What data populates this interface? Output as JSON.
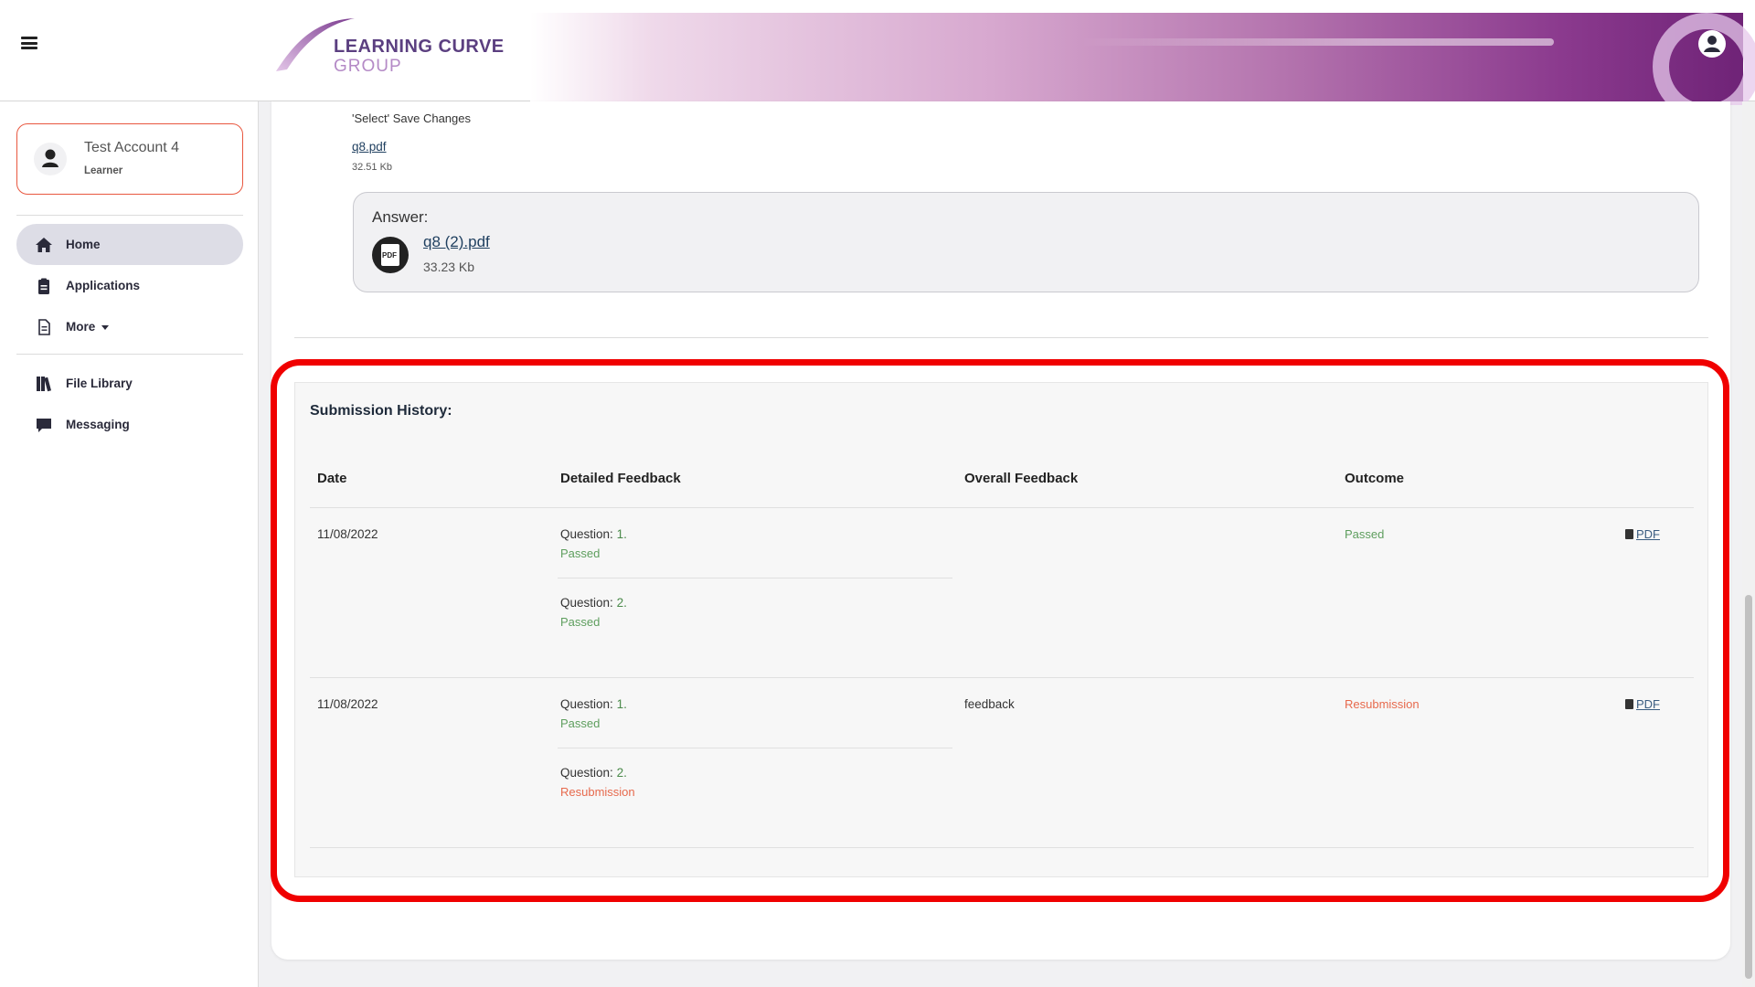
{
  "header": {
    "logo_line1": "LEARNING CURVE",
    "logo_line2": "GROUP"
  },
  "sidebar": {
    "account": {
      "name": "Test Account 4",
      "role": "Learner"
    },
    "items": [
      {
        "label": "Home",
        "icon": "home-icon",
        "active": true
      },
      {
        "label": "Applications",
        "icon": "clipboard-icon"
      },
      {
        "label": "More",
        "icon": "document-icon"
      },
      {
        "label": "File Library",
        "icon": "books-icon"
      },
      {
        "label": "Messaging",
        "icon": "chat-icon"
      }
    ]
  },
  "question": {
    "step_text": "'Select' Save Changes",
    "file_name": "q8.pdf",
    "file_size": "32.51 Kb"
  },
  "answer": {
    "label": "Answer:",
    "file_name": "q8 (2).pdf",
    "file_size": "33.23 Kb"
  },
  "history": {
    "title": "Submission History:",
    "columns": [
      "Date",
      "Detailed Feedback",
      "Overall Feedback",
      "Outcome"
    ],
    "rows": [
      {
        "date": "11/08/2022",
        "questions": [
          {
            "label": "Question:",
            "num": "1.",
            "status": "Passed"
          },
          {
            "label": "Question:",
            "num": "2.",
            "status": "Passed"
          }
        ],
        "overall": "",
        "outcome": "Passed",
        "pdf": "PDF"
      },
      {
        "date": "11/08/2022",
        "questions": [
          {
            "label": "Question:",
            "num": "1.",
            "status": "Passed"
          },
          {
            "label": "Question:",
            "num": "2.",
            "status": "Resubmission"
          }
        ],
        "overall": "feedback",
        "outcome": "Resubmission",
        "pdf": "PDF"
      }
    ]
  },
  "colors": {
    "brand_purple": "#6f2377",
    "passed": "#5e9e5e",
    "resubmission": "#e76a4d",
    "highlight": "#f00000",
    "account_border": "#e8573f"
  }
}
